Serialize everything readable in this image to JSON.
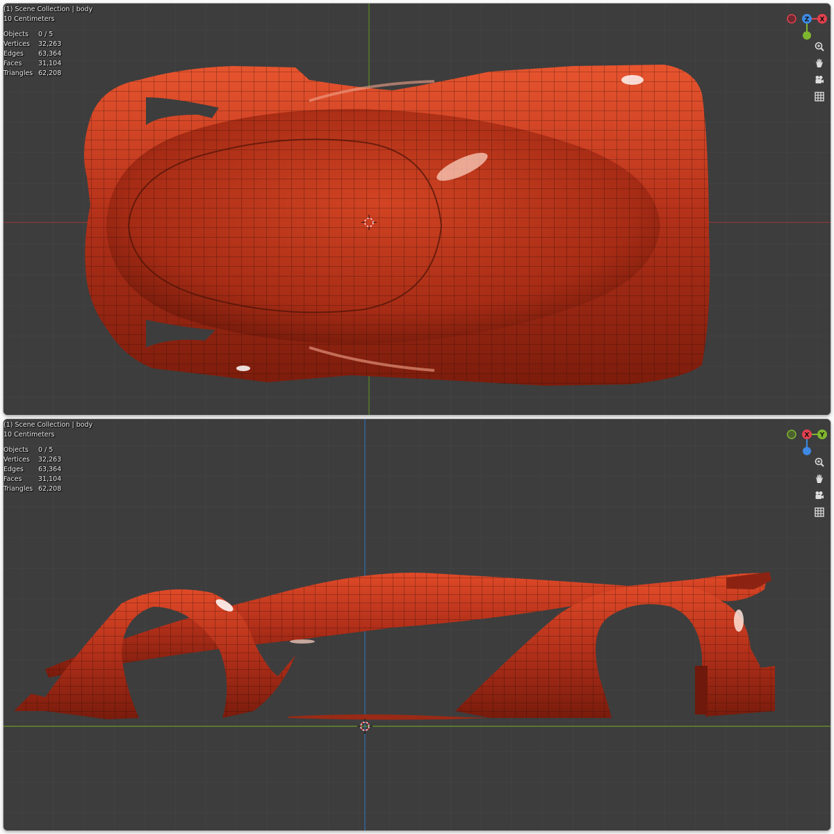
{
  "viewports": [
    {
      "view": "top",
      "header": "(1) Scene Collection | body",
      "scale": "10 Centimeters",
      "stats": [
        {
          "label": "Objects",
          "value": "0 / 5"
        },
        {
          "label": "Vertices",
          "value": "32,263"
        },
        {
          "label": "Edges",
          "value": "63,364"
        },
        {
          "label": "Faces",
          "value": "31,104"
        },
        {
          "label": "Triangles",
          "value": "62,208"
        }
      ],
      "gizmo": {
        "center_axis": "Z",
        "right_axis": "X",
        "axes": [
          "Z",
          "X"
        ]
      }
    },
    {
      "view": "side",
      "header": "(1) Scene Collection | body",
      "scale": "10 Centimeters",
      "stats": [
        {
          "label": "Objects",
          "value": "0 / 5"
        },
        {
          "label": "Vertices",
          "value": "32,263"
        },
        {
          "label": "Edges",
          "value": "63,364"
        },
        {
          "label": "Faces",
          "value": "31,104"
        },
        {
          "label": "Triangles",
          "value": "62,208"
        }
      ],
      "gizmo": {
        "center_axis": "X",
        "right_axis": "Y",
        "axes": [
          "X",
          "Y"
        ]
      }
    }
  ],
  "tools": [
    "zoom-icon",
    "pan-hand-icon",
    "camera-icon",
    "grid-view-icon"
  ],
  "colors": {
    "viewport_bg": "#3d3d3d",
    "grid_minor": "#474747",
    "grid_major": "#535353",
    "axis_x": "#a33a3a",
    "axis_y": "#6a9c28",
    "axis_z": "#2f6fb3",
    "body_paint": "#c4381a",
    "wire": "#2a0c05",
    "gizmo_x": "#e2404e",
    "gizmo_y": "#7fb62f",
    "gizmo_z": "#3d89e3"
  }
}
